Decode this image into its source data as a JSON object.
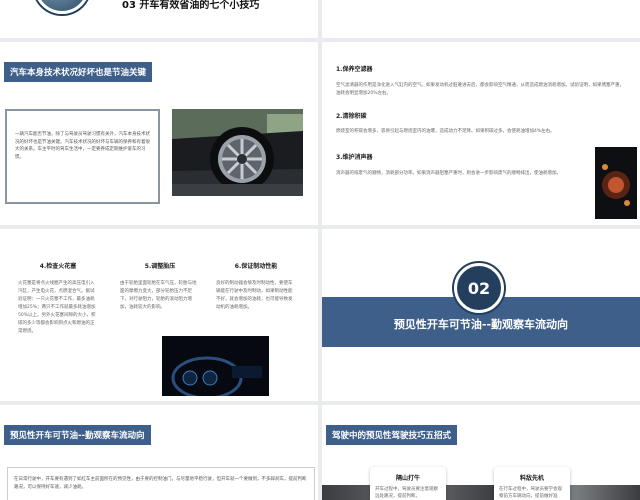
{
  "slide1": {
    "title": "03 开车有效省油的七个小技巧"
  },
  "slide3": {
    "tag": "汽车本身技术状况好坏也是节油关键",
    "body": "一辆汽车能否节油，除了与驾驶员驾驶习惯有关外，汽车本身技术状况的好坏也是节油关键。汽车技术状况的好坏与车辆的保养和有着很大的关系。车主平时的驾车生活中，一定要养成定期维护爱车的习惯。"
  },
  "slide4": {
    "items": [
      {
        "head": "1.保养空滤器",
        "text": "空气滤清器的作用是净化进入气缸内的空气。如果发动机过脏难进去后，都会影响空气精通，从而造成燃油消耗增加。试验证明，如果堵塞严重，油耗会明显增加20%左右。"
      },
      {
        "head": "2.清除积碳",
        "text": "燃烧室的积碳会增多，容易引起与燃烧室内的油爆，造成动力不足降。如果积碳过多，会使耗油增加4%左右。"
      },
      {
        "head": "3.维护消声器",
        "text": "消声器的排废气的顺畅，消耗部分功率。如果消声器阻塞严重时，则会进一步影响废气的顺畅排出，使油耗增加。"
      }
    ]
  },
  "slide5": {
    "cols": [
      {
        "head": "4.检查火花塞",
        "text": "火花塞是将点火线圈产生的高压电引入汽缸，产生电火花，点燃混合气。据试验证明：一只火花塞不工作，最多油耗增加25%；两只不工作就最多耗油增加50%以上。另外火花塞间隙的大小，积碳的多少等都会影响到点火和燃油的正常燃烧。"
      },
      {
        "head": "5.调整胎压",
        "text": "由于轮胎里面轮胎在车气压，轮胎与地面的摩擦力变大，部分轮胎压力不足下，对行驶阻力，轮胎的滚动阻力增加，油耗较大的影响。"
      },
      {
        "head": "6.保证制动性能",
        "text": "良好的制动器会够及时制动性，要使车辆能在行驶中及时制动，如果制动性能不好，就会增加的油耗，也可能导致发动机的油耗增加。"
      }
    ]
  },
  "slide6": {
    "number": "02",
    "title": "预见性开车可节油--勤观察车流动向"
  },
  "slide7": {
    "tag": "预见性开车可节油--勤观察车流动向",
    "body": "在日常行驶中，开车要有遇到了如红车主前面所在的预见性，由于要的控制油门，与尽量地平稳行驶，但开车就一个要做到，不多踩刹车，提前判断路况，可以保持好车速，减少油耗。"
  },
  "slide8": {
    "tag": "驾驶中的预见性驾驶技巧五招式",
    "cards": [
      {
        "head": "隔山打牛",
        "text": "开车过程中，驾驶员要注意观察远处路况，提前判断。"
      },
      {
        "head": "料敌先机",
        "text": "在行车过程中，驾驶员要学会观察前方车辆动向，提前做好准备。"
      }
    ]
  }
}
